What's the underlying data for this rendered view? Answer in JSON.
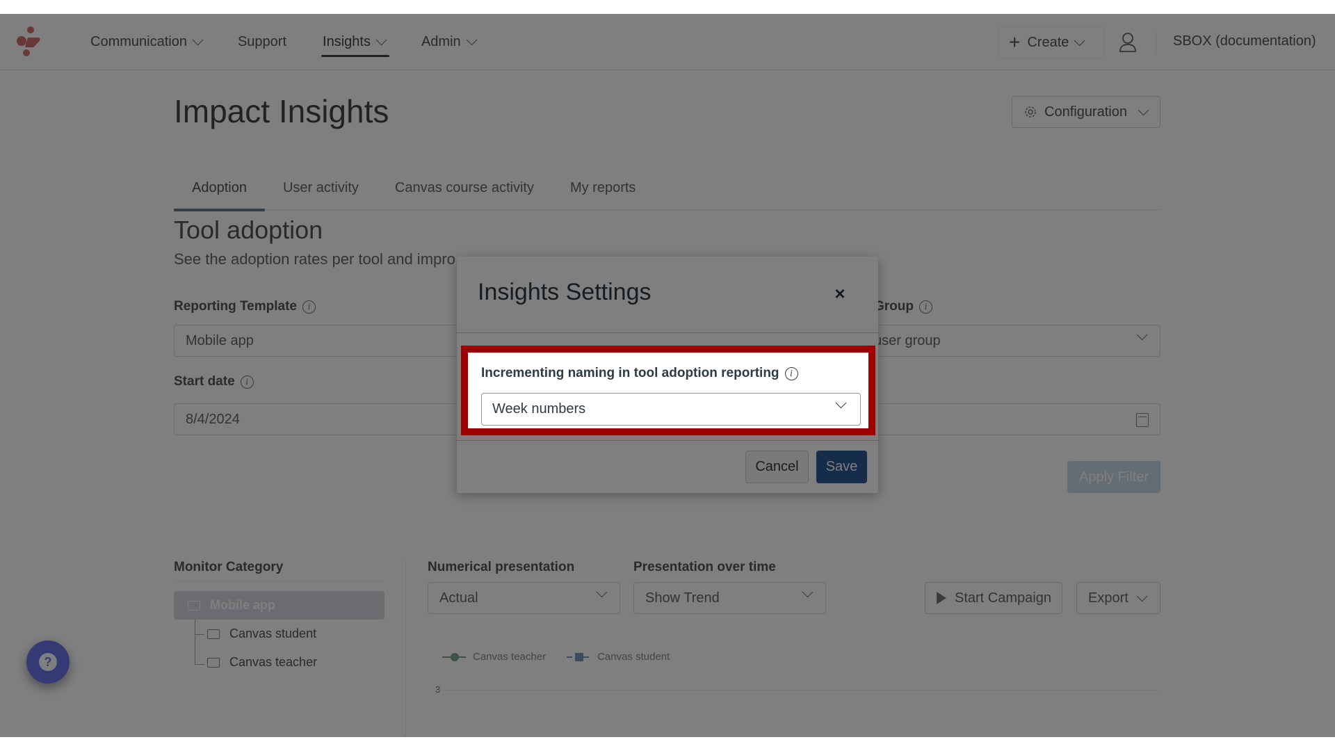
{
  "header": {
    "nav": [
      {
        "label": "Communication",
        "has_dropdown": true,
        "active": false
      },
      {
        "label": "Support",
        "has_dropdown": false,
        "active": false
      },
      {
        "label": "Insights",
        "has_dropdown": true,
        "active": true
      },
      {
        "label": "Admin",
        "has_dropdown": true,
        "active": false
      }
    ],
    "create_label": "Create",
    "account_label": "SBOX (documentation)"
  },
  "page": {
    "title": "Impact Insights",
    "config_label": "Configuration",
    "tabs": [
      {
        "label": "Adoption",
        "active": true
      },
      {
        "label": "User activity",
        "active": false
      },
      {
        "label": "Canvas course activity",
        "active": false
      },
      {
        "label": "My reports",
        "active": false
      }
    ],
    "section_title": "Tool adoption",
    "section_subtitle": "See the adoption rates per tool and impro",
    "reporting_template_label": "Reporting Template",
    "reporting_template_value": "Mobile app",
    "group_label": "Group",
    "group_value": "user group",
    "start_date_label": "Start date",
    "start_date_value": "8/4/2024",
    "apply_filter_label": "Apply Filter",
    "monitor_category_label": "Monitor Category",
    "monitor_items": [
      {
        "label": "Mobile app",
        "selected": true
      },
      {
        "label": "Canvas student",
        "selected": false
      },
      {
        "label": "Canvas teacher",
        "selected": false
      }
    ],
    "numerical_label": "Numerical presentation",
    "numerical_value": "Actual",
    "over_time_label": "Presentation over time",
    "over_time_value": "Show Trend",
    "start_campaign_label": "Start Campaign",
    "export_label": "Export",
    "legend": [
      "Canvas teacher",
      "Canvas student"
    ],
    "y_tick": "3"
  },
  "modal": {
    "title": "Insights Settings",
    "close_symbol": "×",
    "setting_label": "Incrementing naming in tool adoption reporting",
    "setting_value": "Week numbers",
    "cancel_label": "Cancel",
    "save_label": "Save"
  },
  "help": {
    "symbol": "?"
  },
  "info_symbol": "i",
  "colors": {
    "highlight_border": "#a00000",
    "save_button": "#2b5b93",
    "help_button": "#6a74e8"
  }
}
